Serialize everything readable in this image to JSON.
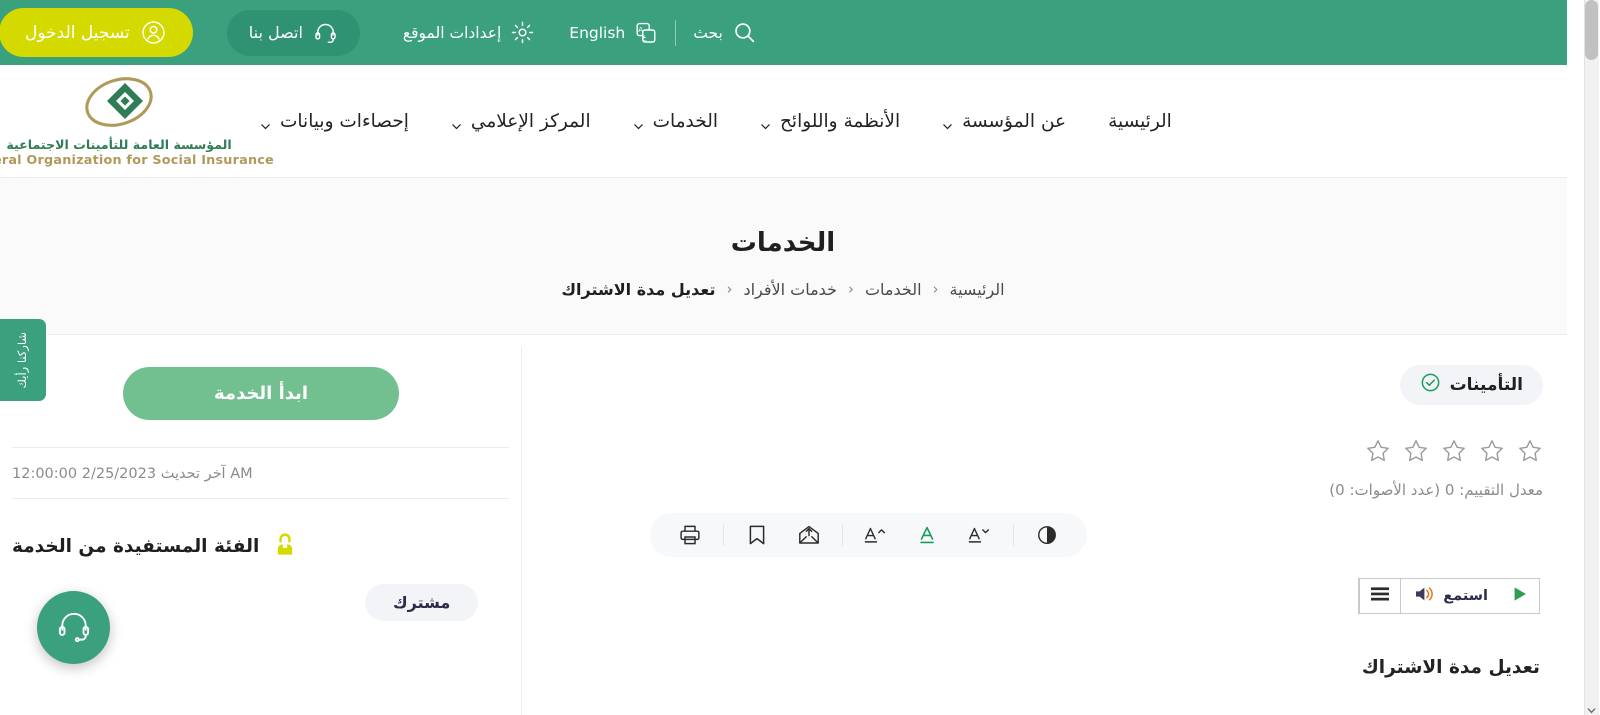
{
  "colors": {
    "header_green": "#3aa07d",
    "contact_green": "#2f9272",
    "login_yellow": "#d4d900",
    "start_button_green": "#72bf8f",
    "logo_green": "#2f7d55",
    "logo_gold": "#b09a5a",
    "tag_bg": "#f3f4f7",
    "accent_text_green": "#1a9c5b",
    "beneficiary_icon_yellow": "#d4d900",
    "play_green": "#2e9e55",
    "speaker_orange": "#e8751a"
  },
  "topbar": {
    "search": {
      "label": "بحث",
      "icon": "search-icon"
    },
    "language": {
      "label": "English",
      "icon": "language-switch-icon"
    },
    "site_settings": {
      "label": "إعدادات الموقع",
      "icon": "gear-icon"
    },
    "contact": {
      "label": "اتصل بنا",
      "icon": "headset-icon"
    },
    "login": {
      "label": "تسجيل الدخول",
      "icon": "user-circle-icon"
    }
  },
  "logo": {
    "arabic": "المؤسسة العامة للتأمينات الاجتماعية",
    "english": "General Organization for Social Insurance"
  },
  "nav": {
    "items": [
      {
        "label": "الرئيسية",
        "has_dropdown": false
      },
      {
        "label": "عن المؤسسة",
        "has_dropdown": true
      },
      {
        "label": "الأنظمة واللوائح",
        "has_dropdown": true
      },
      {
        "label": "الخدمات",
        "has_dropdown": true
      },
      {
        "label": "المركز الإعلامي",
        "has_dropdown": true
      },
      {
        "label": "إحصاءات وبيانات",
        "has_dropdown": true
      }
    ]
  },
  "page": {
    "title": "الخدمات",
    "breadcrumb": [
      {
        "label": "الرئيسية",
        "active": false
      },
      {
        "label": "الخدمات",
        "active": false
      },
      {
        "label": "خدمات الأفراد",
        "active": false
      },
      {
        "label": "تعديل مدة الاشتراك",
        "active": true
      }
    ],
    "breadcrumb_separator": "‹"
  },
  "main": {
    "insurance_badge": {
      "label": "التأمينات",
      "icon": "check-circle-icon"
    },
    "rating": {
      "stars_total": 5,
      "stars_filled": 0,
      "text": "معدل التقييم: 0 (عدد الأصوات: 0)"
    },
    "toolbar": {
      "items": [
        {
          "name": "contrast-icon",
          "label": "تباين"
        },
        {
          "name": "font-decrease-icon",
          "label": "تصغير الخط"
        },
        {
          "name": "font-reset-icon",
          "label": "الخط الافتراضي"
        },
        {
          "name": "font-increase-icon",
          "label": "تكبير الخط"
        },
        {
          "name": "share-envelope-icon",
          "label": "مشاركة"
        },
        {
          "name": "bookmark-icon",
          "label": "إضافة للمفضلة"
        },
        {
          "name": "print-icon",
          "label": "طباعة"
        }
      ]
    },
    "player": {
      "menu_icon": "hamburger-menu-icon",
      "listen_label": "استمع",
      "speaker_icon": "speaker-icon",
      "play_icon": "play-icon"
    },
    "service_name": "تعديل مدة الاشتراك"
  },
  "sidebar": {
    "start_button": "ابدأ الخدمة",
    "last_updated_prefix": "آخر تحديث",
    "last_updated_value": "2/25/2023 12:00:00 AM",
    "last_updated_full": "آخر تحديث 2/25/2023 12:00:00 AM",
    "beneficiary_label": "الفئة المستفيدة من الخدمة",
    "beneficiary_icon": "user-beneficiary-icon",
    "beneficiary_tag": "مشترك"
  },
  "floating": {
    "feedback_tab": "شاركنا رأيك",
    "support_button_icon": "headset-icon"
  }
}
